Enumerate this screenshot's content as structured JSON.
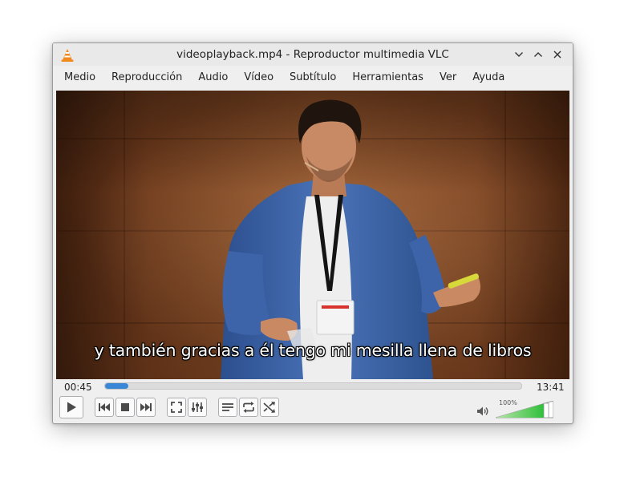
{
  "window": {
    "title": "videoplayback.mp4 - Reproductor multimedia VLC",
    "app_icon": "vlc-cone-icon"
  },
  "menu": {
    "items": [
      "Medio",
      "Reproducción",
      "Audio",
      "Vídeo",
      "Subtítulo",
      "Herramientas",
      "Ver",
      "Ayuda"
    ]
  },
  "video": {
    "subtitle": "y también gracias a él tengo mi mesilla llena de libros"
  },
  "playback": {
    "elapsed": "00:45",
    "total": "13:41",
    "progress_fraction": 0.055
  },
  "volume": {
    "label": "100%",
    "level_fraction": 1.0
  },
  "colors": {
    "accent": "#3a87d6",
    "volume_green": "#2fbf3a"
  },
  "controls": {
    "icons": [
      "play-icon",
      "previous-icon",
      "stop-icon",
      "next-icon",
      "fullscreen-icon",
      "extended-settings-icon",
      "playlist-icon",
      "loop-icon",
      "shuffle-icon",
      "volume-icon"
    ]
  }
}
